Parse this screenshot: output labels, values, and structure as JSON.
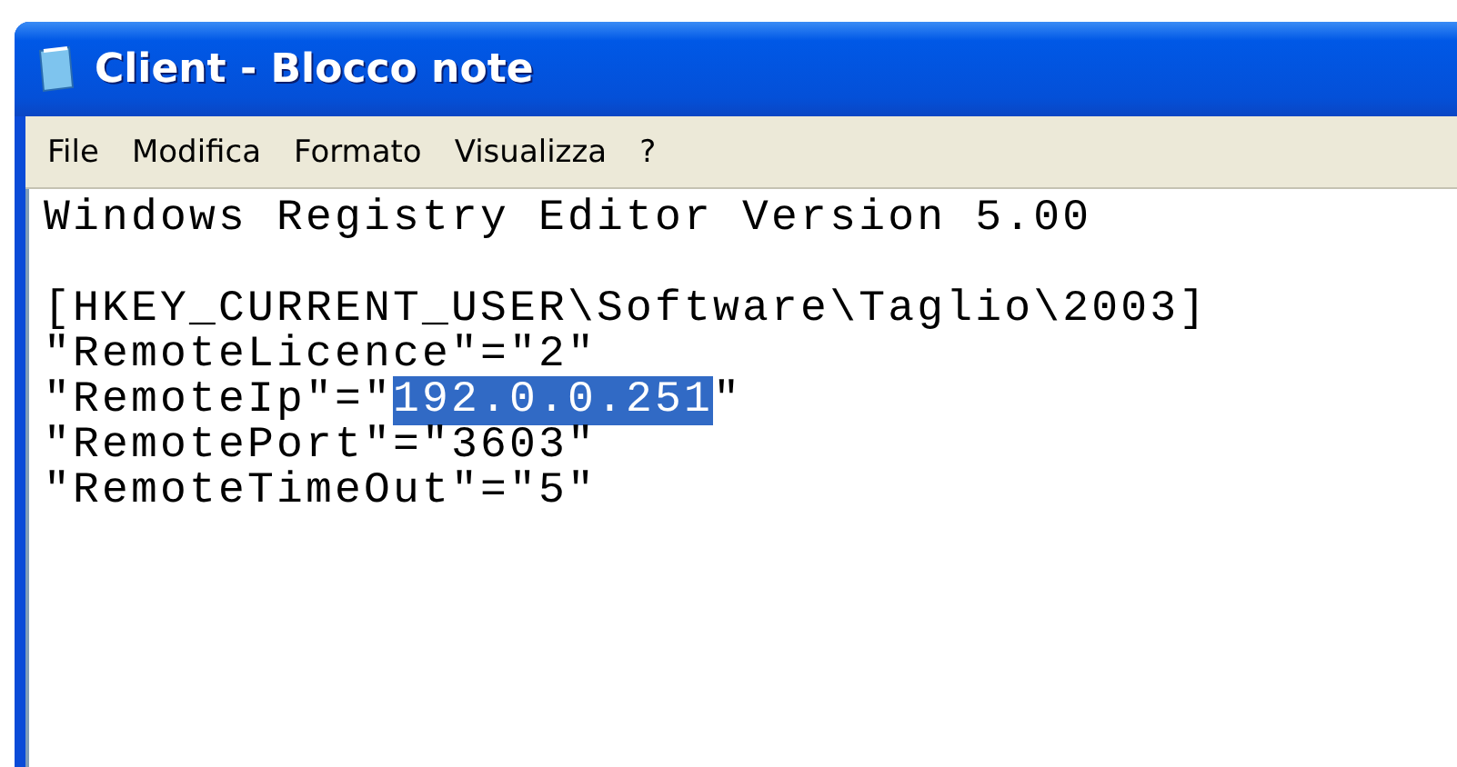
{
  "window": {
    "title": "Client - Blocco note"
  },
  "menu": [
    "File",
    "Modifica",
    "Formato",
    "Visualizza",
    "?"
  ],
  "document": {
    "lines": [
      {
        "kind": "text",
        "segments": [
          {
            "text": "Windows Registry Editor Version 5.00",
            "selected": false
          }
        ]
      },
      {
        "kind": "blank"
      },
      {
        "kind": "text",
        "segments": [
          {
            "text": "[HKEY_CURRENT_USER\\Software\\Taglio\\2003]",
            "selected": false
          }
        ]
      },
      {
        "kind": "text",
        "segments": [
          {
            "text": "\"RemoteLicence\"=\"2\"",
            "selected": false
          }
        ]
      },
      {
        "kind": "text",
        "segments": [
          {
            "text": "\"RemoteIp\"=\"",
            "selected": false
          },
          {
            "text": "192.0.0.251",
            "selected": true
          },
          {
            "text": "\"",
            "selected": false
          }
        ]
      },
      {
        "kind": "text",
        "segments": [
          {
            "text": "\"RemotePort\"=\"3603\"",
            "selected": false
          }
        ]
      },
      {
        "kind": "text",
        "segments": [
          {
            "text": "\"RemoteTimeOut\"=\"5\"",
            "selected": false
          }
        ]
      }
    ]
  }
}
